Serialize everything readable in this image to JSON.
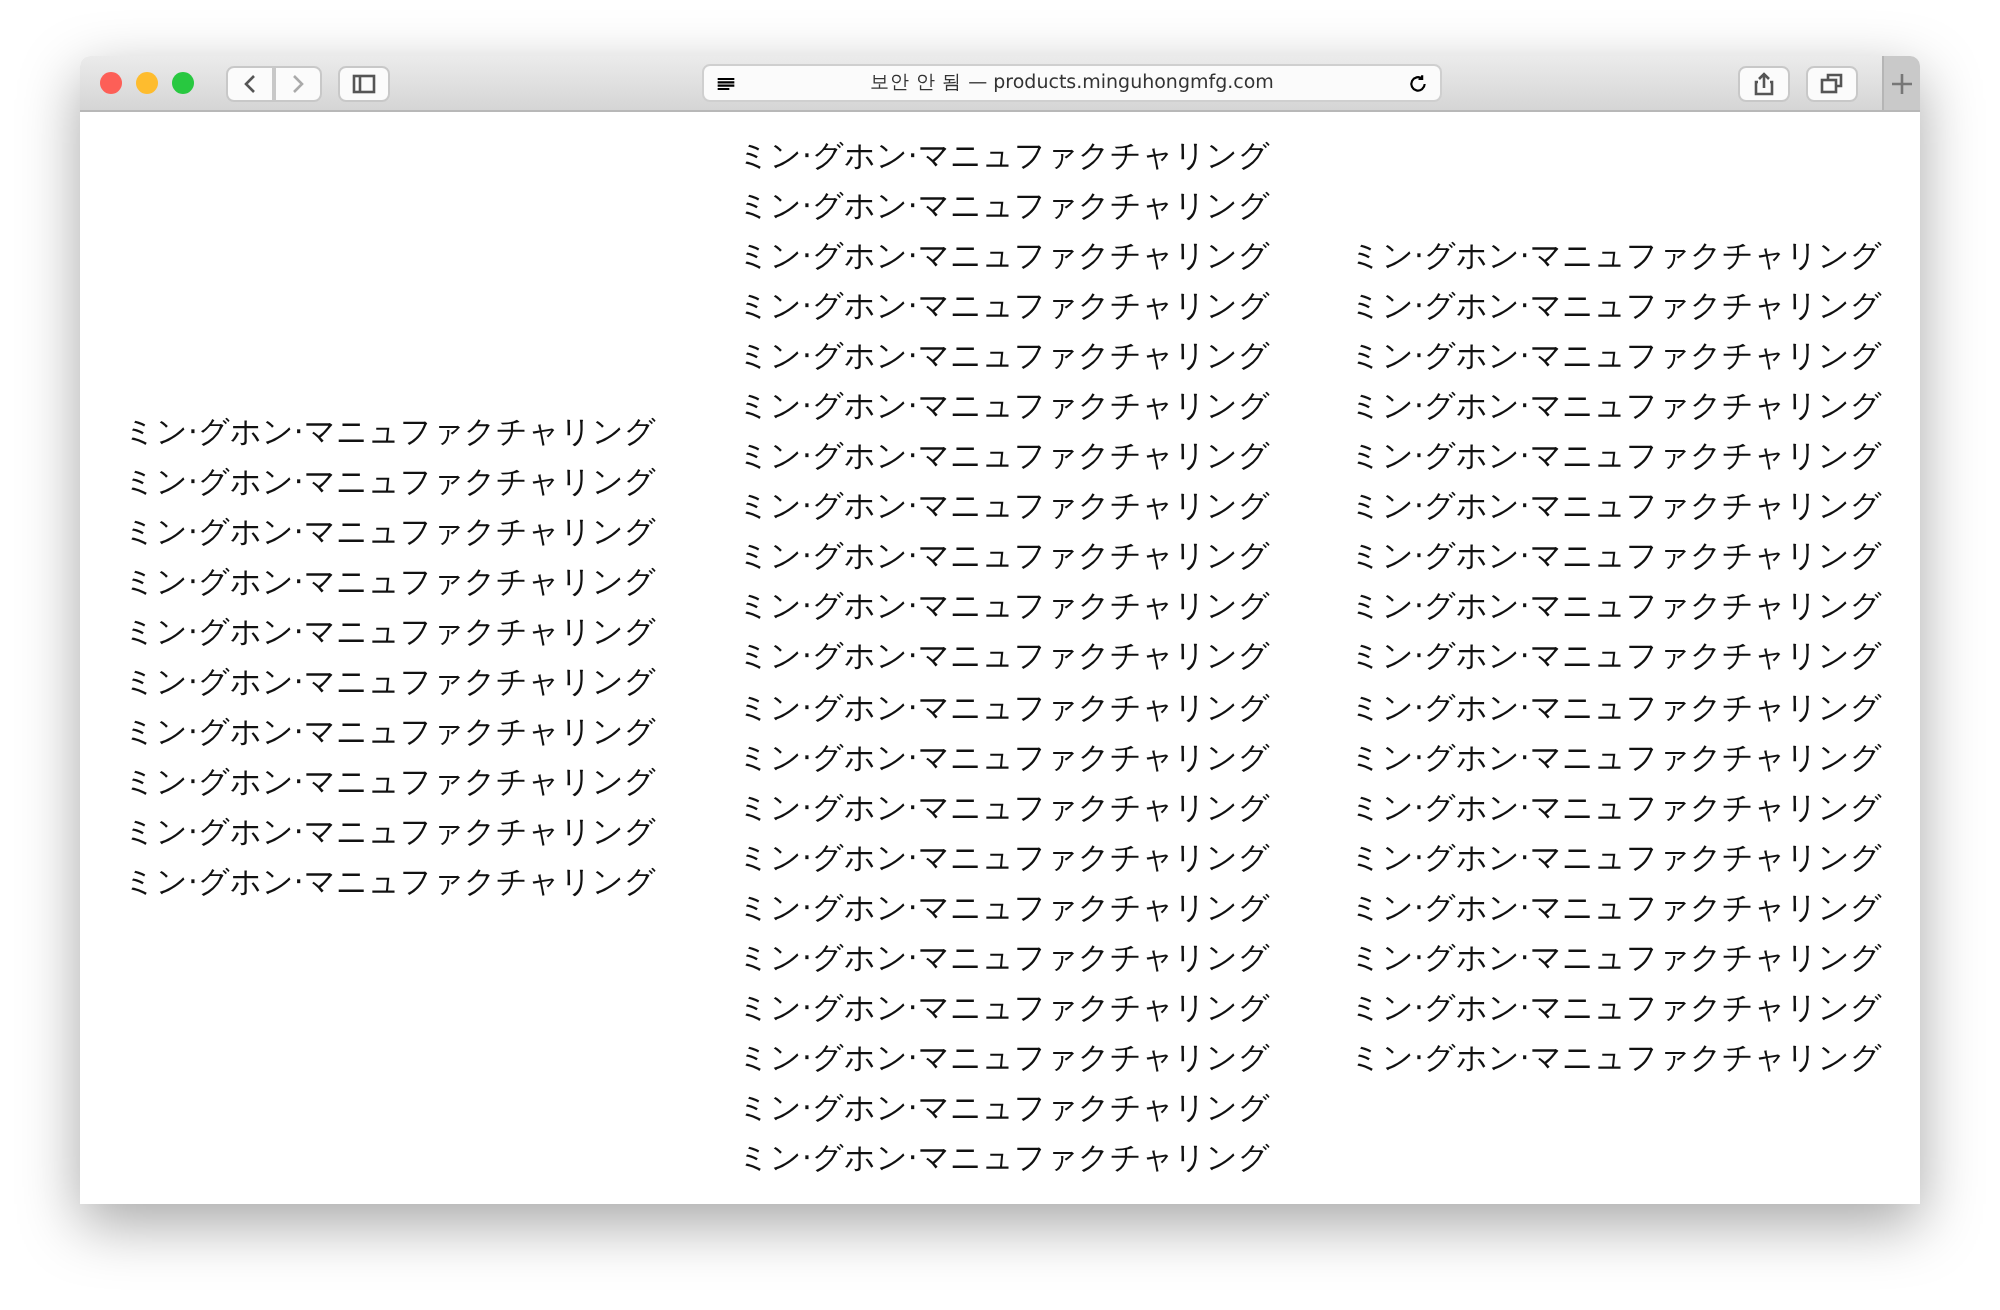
{
  "window": {
    "address": "보안 안 됨 — products.minguhongmfg.com"
  },
  "columns": [
    {
      "lines": [
        "ミン·グホン·マニュファクチャリング",
        "ミン·グホン·マニュファクチャリング",
        "ミン·グホン·マニュファクチャリング",
        "ミン·グホン·マニュファクチャリング",
        "ミン·グホン·マニュファクチャリング",
        "ミン·グホン·マニュファクチャリング",
        "ミン·グホン·マニュファクチャリング",
        "ミン·グホン·マニュファクチャリング",
        "ミン·グホン·マニュファクチャリング",
        "ミン·グホン·マニュファクチャリング"
      ]
    },
    {
      "lines": [
        "ミン·グホン·マニュファクチャリング",
        "ミン·グホン·マニュファクチャリング",
        "ミン·グホン·マニュファクチャリング",
        "ミン·グホン·マニュファクチャリング",
        "ミン·グホン·マニュファクチャリング",
        "ミン·グホン·マニュファクチャリング",
        "ミン·グホン·マニュファクチャリング",
        "ミン·グホン·マニュファクチャリング",
        "ミン·グホン·マニュファクチャリング",
        "ミン·グホン·マニュファクチャリング",
        "ミン·グホン·マニュファクチャリング",
        "ミン·グホン·マニュファクチャリング",
        "ミン·グホン·マニュファクチャリング",
        "ミン·グホン·マニュファクチャリング",
        "ミン·グホン·マニュファクチャリング",
        "ミン·グホン·マニュファクチャリング",
        "ミン·グホン·マニュファクチャリング",
        "ミン·グホン·マニュファクチャリング",
        "ミン·グホン·マニュファクチャリング",
        "ミン·グホン·マニュファクチャリング",
        "ミン·グホン·マニュファクチャリング"
      ]
    },
    {
      "lines": [
        "ミン·グホン·マニュファクチャリング",
        "ミン·グホン·マニュファクチャリング",
        "ミン·グホン·マニュファクチャリング",
        "ミン·グホン·マニュファクチャリング",
        "ミン·グホン·マニュファクチャリング",
        "ミン·グホン·マニュファクチャリング",
        "ミン·グホン·マニュファクチャリング",
        "ミン·グホン·マニュファクチャリング",
        "ミン·グホン·マニュファクチャリング",
        "ミン·グホン·マニュファクチャリング",
        "ミン·グホン·マニュファクチャリング",
        "ミン·グホン·マニュファクチャリング",
        "ミン·グホン·マニュファクチャリング",
        "ミン·グホン·マニュファクチャリング",
        "ミン·グホン·マニュファクチャリング",
        "ミン·グホン·マニュファクチャリング",
        "ミン·グホン·マニュファクチャリング"
      ]
    }
  ]
}
